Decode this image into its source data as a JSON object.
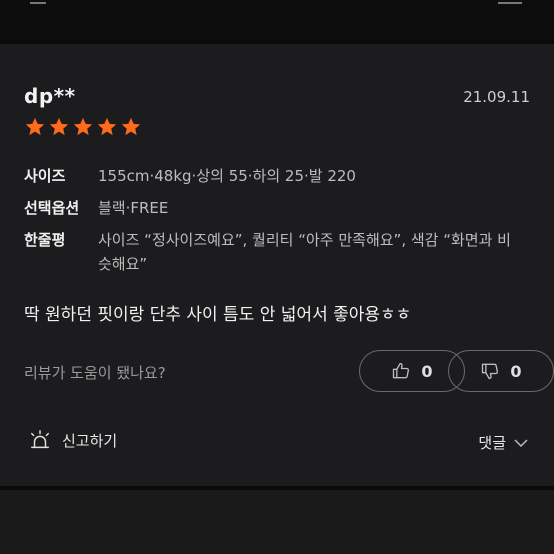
{
  "review": {
    "username": "dp**",
    "date": "21.09.11",
    "rating": 5,
    "size_label": "사이즈",
    "size_value": "155cm·48kg·상의 55·하의 25·발 220",
    "option_label": "선택옵션",
    "option_value": "블랙·FREE",
    "short_label": "한줄평",
    "short_value": "사이즈 “정사이즈예요”, 퀄리티 “아주 만족해요”, 색감 “화면과 비슷해요”",
    "body": "딱 원하던 핏이랑 단추 사이 틈도 안 넓어서 좋아용ㅎㅎ"
  },
  "helpful": {
    "question": "리뷰가 도움이 됐나요?",
    "up_count": "0",
    "down_count": "0"
  },
  "footer": {
    "report_label": "신고하기",
    "comments_label": "댓글"
  },
  "colors": {
    "star": "#ff6b1a",
    "card_bg": "#1c1c1e",
    "page_bg": "#0a0a0a"
  },
  "icons": {
    "star": "star-icon",
    "thumbs_up": "thumbs-up-icon",
    "thumbs_down": "thumbs-down-icon",
    "report": "alarm-siren-icon",
    "chevron": "chevron-down-icon"
  }
}
